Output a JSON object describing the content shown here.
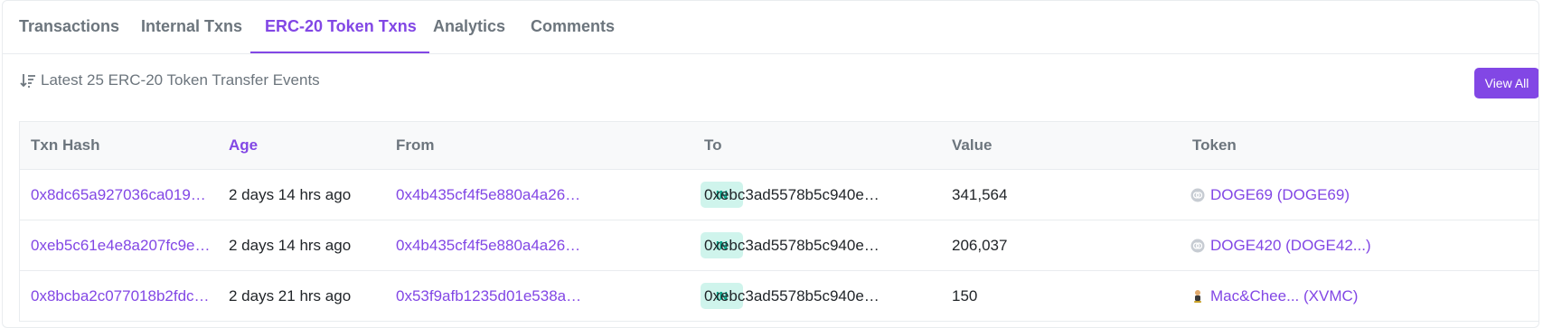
{
  "tabs": [
    {
      "label": "Transactions",
      "active": false
    },
    {
      "label": "Internal Txns",
      "active": false
    },
    {
      "label": "ERC-20 Token Txns",
      "active": true
    },
    {
      "label": "Analytics",
      "active": false
    },
    {
      "label": "Comments",
      "active": false
    }
  ],
  "summary": {
    "text": "Latest 25 ERC-20 Token Transfer Events",
    "sort_icon": "sort-descending-icon"
  },
  "view_all_label": "View All",
  "table": {
    "headers": [
      "Txn Hash",
      "Age",
      "From",
      "To",
      "Value",
      "Token"
    ],
    "rows": [
      {
        "hash": "0x8dc65a927036ca019a…",
        "age": "2 days 14 hrs ago",
        "from": "0x4b435cf4f5e880a4a26…",
        "direction": "IN",
        "to": "0xebc3ad5578b5c940e6…",
        "value": "341,564",
        "token": "DOGE69 (DOGE69)",
        "token_icon": "generic-token-icon"
      },
      {
        "hash": "0xeb5c61e4e8a207fc9ef…",
        "age": "2 days 14 hrs ago",
        "from": "0x4b435cf4f5e880a4a26…",
        "direction": "IN",
        "to": "0xebc3ad5578b5c940e6…",
        "value": "206,037",
        "token": "DOGE420 (DOGE42...)",
        "token_icon": "generic-token-icon"
      },
      {
        "hash": "0x8bcba2c077018b2fdc7…",
        "age": "2 days 21 hrs ago",
        "from": "0x53f9afb1235d01e538a…",
        "direction": "IN",
        "to": "0xebc3ad5578b5c940e6…",
        "value": "150",
        "token": "Mac&Chee... (XVMC)",
        "token_icon": "mascot-token-icon"
      }
    ]
  },
  "colors": {
    "accent": "#8247e5",
    "in_badge_bg": "#cff4ec",
    "in_badge_text": "#00a186"
  }
}
